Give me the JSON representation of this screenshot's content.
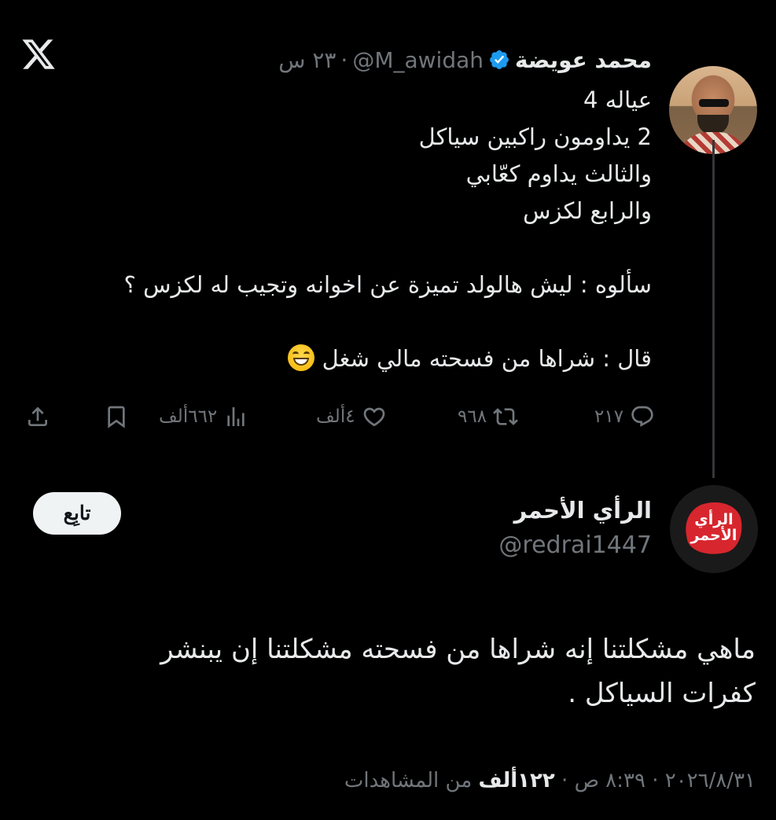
{
  "tweet": {
    "author_name": "محمد عويضة",
    "handle": "@M_awidah",
    "separator": "·",
    "time": "٢٣ س",
    "lines": [
      "عياله 4",
      "2 يداومون راكبين سياكل",
      "والثالث يداوم كعّابي",
      "والرابع لكزس",
      "",
      "سألوه : ليش هالولد تميزة عن اخوانه وتجيب له لكزس ؟",
      "",
      "قال : شراها من فسحته مالي شغل"
    ],
    "emoji": "grinning-face-with-smiling-eyes",
    "stats": {
      "replies": "٢١٧",
      "retweets": "٩٦٨",
      "likes": "٤ألف",
      "views": "٦٦٢ألف"
    }
  },
  "reply": {
    "author_name": "الرأي الأحمر",
    "handle": "@redrai1447",
    "avatar_text": "الرأي الأحمر",
    "follow_label": "تابِع",
    "lines": [
      "ماهي مشكلتنا إنه شراها من فسحته مشكلتنا إن يبنشر",
      "كفرات السياكل ."
    ],
    "meta": {
      "date": "٢٠٢٦/٨/٣١",
      "separator": "·",
      "time": "٨:٣٩ ص",
      "views_count": "١٢٢ألف",
      "views_label": "من المشاهدات"
    }
  },
  "colors": {
    "background": "#000000",
    "text": "#e7e9ea",
    "secondary": "#71767b",
    "verified": "#1d9bf0",
    "follow_bg": "#eff3f4"
  },
  "icons": [
    "x-logo-icon",
    "verified-badge-icon",
    "reply-icon",
    "retweet-icon",
    "like-icon",
    "views-icon",
    "bookmark-icon",
    "share-icon"
  ]
}
